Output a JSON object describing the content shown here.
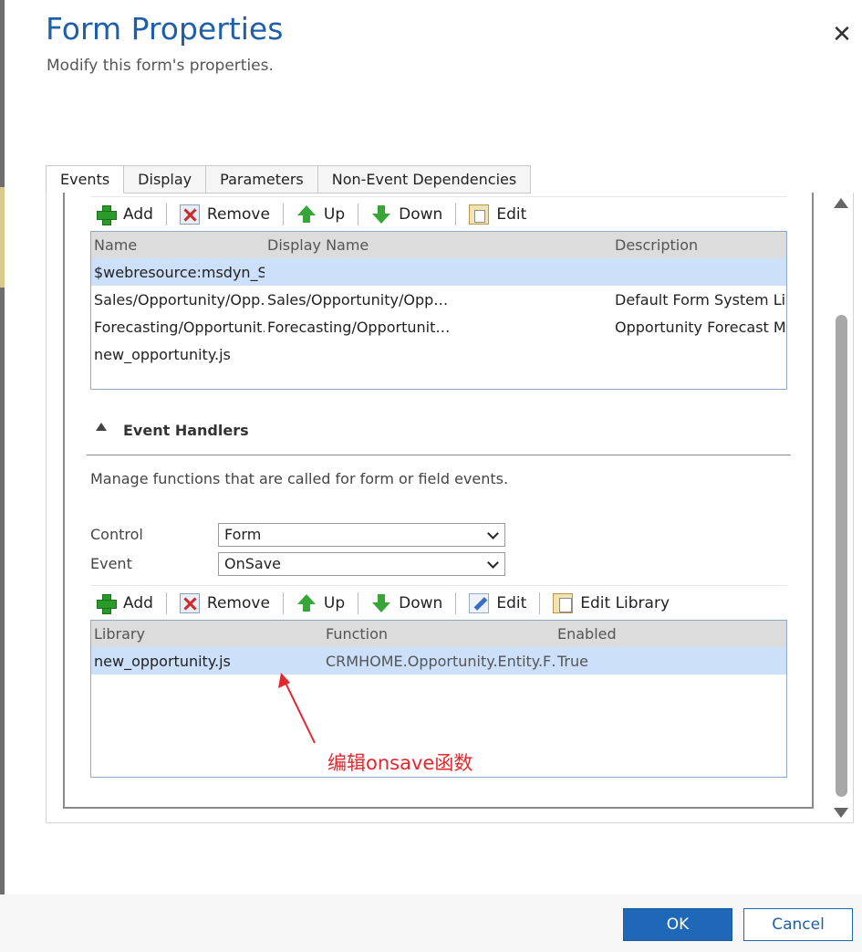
{
  "dialog": {
    "title": "Form Properties",
    "subtitle": "Modify this form's properties.",
    "close_symbol": "✕"
  },
  "tabs": [
    {
      "label": "Events",
      "selected": true
    },
    {
      "label": "Display"
    },
    {
      "label": "Parameters"
    },
    {
      "label": "Non-Event Dependencies"
    }
  ],
  "libraries_toolbar": {
    "add": "Add",
    "remove": "Remove",
    "up": "Up",
    "down": "Down",
    "edit": "Edit"
  },
  "libraries_grid": {
    "columns": [
      "Name",
      "Display Name",
      "Description"
    ],
    "rows": [
      {
        "name": "$webresource:msdyn_S…",
        "display_name": "",
        "description": "",
        "selected": true
      },
      {
        "name": "Sales/Opportunity/Opp…",
        "display_name": "Sales/Opportunity/Opp…",
        "description": "Default Form System Li…"
      },
      {
        "name": "Forecasting/Opportunit…",
        "display_name": "Forecasting/Opportunit…",
        "description": "Opportunity Forecast M…"
      },
      {
        "name": "new_opportunity.js",
        "display_name": "",
        "description": ""
      }
    ]
  },
  "event_handlers": {
    "title": "Event Handlers",
    "description": "Manage functions that are called for form or field events.",
    "control_label": "Control",
    "control_value": "Form",
    "event_label": "Event",
    "event_value": "OnSave"
  },
  "handlers_toolbar": {
    "add": "Add",
    "remove": "Remove",
    "up": "Up",
    "down": "Down",
    "edit": "Edit",
    "edit_library": "Edit Library"
  },
  "handlers_grid": {
    "columns": [
      "Library",
      "Function",
      "Enabled"
    ],
    "rows": [
      {
        "library": "new_opportunity.js",
        "function": "CRMHOME.Opportunity.Entity.F…",
        "enabled": "True",
        "selected": true
      }
    ]
  },
  "annotation": {
    "text": "编辑onsave函数",
    "color": "#e6262e"
  },
  "footer": {
    "ok": "OK",
    "cancel": "Cancel"
  },
  "colors": {
    "accent": "#1f68b8",
    "title": "#1f5fa8",
    "selected_row": "#cce0fa"
  }
}
